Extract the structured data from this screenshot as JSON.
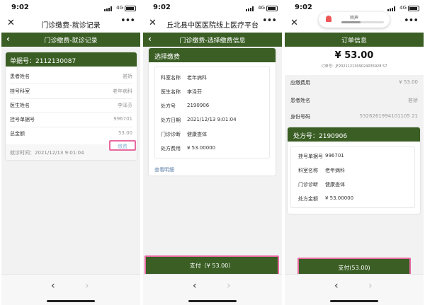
{
  "status": {
    "time": "9:02",
    "network": "4G"
  },
  "panel1": {
    "app_title": "门诊缴费-就诊记录",
    "page_title": "门诊缴费-就诊记录",
    "record_header": "单据号：2112130087",
    "rows": [
      {
        "label": "患者姓名",
        "value": "甚娇"
      },
      {
        "label": "挂号科室",
        "value": "老年病科"
      },
      {
        "label": "医生姓名",
        "value": "李泽芬"
      },
      {
        "label": "挂号单据号",
        "value": "996701"
      },
      {
        "label": "总金额",
        "value": "53.00"
      }
    ],
    "visit_time": "就诊时间：2021/12/13 9:01:04",
    "pay_button": "缴费"
  },
  "panel2": {
    "app_title": "丘北县中医医院线上医疗平台",
    "page_title": "门诊缴费-选择缴费信息",
    "section_title": "选择缴费",
    "rows": [
      {
        "label": "科室名称",
        "value": "老年病科"
      },
      {
        "label": "医生名称",
        "value": "李泽芬"
      },
      {
        "label": "处方号",
        "value": "2190906"
      },
      {
        "label": "处方日期",
        "value": "2021/12/13 9:01:04"
      },
      {
        "label": "门诊诊断",
        "value": "健康查体"
      },
      {
        "label": "处方费用",
        "value": "¥ 53.00000"
      }
    ],
    "detail_link": "查看明细",
    "pay_button": "支付（¥ 53.00）"
  },
  "panel3": {
    "toast_label": "铃声",
    "toast_level": 0.45,
    "page_title": "订单信息",
    "amount": "¥ 53.00",
    "order_no": "订单号：JF2021121309024035928 57",
    "rows": [
      {
        "label": "应缴费用",
        "value": "¥ 53.00"
      },
      {
        "label": "患者姓名",
        "value": "甚娇"
      },
      {
        "label": "身份号码",
        "value": "5326261994101105 21"
      }
    ],
    "prescription_header": "处方号：2190906",
    "detail_rows": [
      {
        "label": "挂号单据号",
        "value": "996701"
      },
      {
        "label": "科室名称",
        "value": "老年病科"
      },
      {
        "label": "门诊诊断",
        "value": "健康查体"
      },
      {
        "label": "处方金额",
        "value": "¥ 53.00000"
      }
    ],
    "pay_button": "支付(53.00)"
  },
  "nav": {
    "back": "‹",
    "forward": "›"
  },
  "icons": {
    "close": "close-icon",
    "more": "more-icon",
    "back": "back-arrow-icon",
    "bell": "bell-icon"
  },
  "colors": {
    "brand_green": "#3a5e24",
    "highlight_pink": "#e86aa0",
    "link_blue": "#5b7fa9"
  }
}
